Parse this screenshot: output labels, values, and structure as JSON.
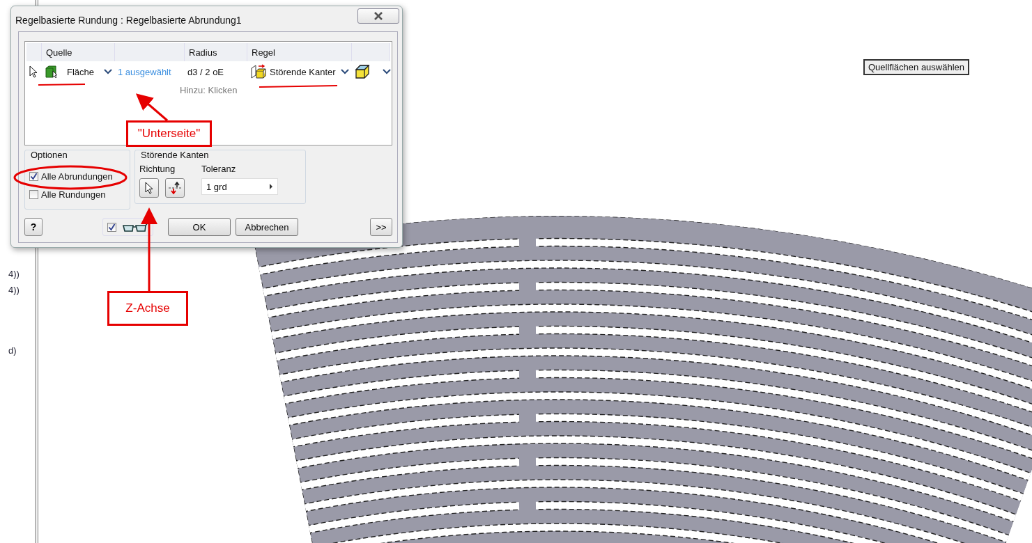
{
  "dialog": {
    "title": "Regelbasierte Rundung : Regelbasierte Abrundung1",
    "table": {
      "columns": [
        {
          "label": "Quelle"
        },
        {
          "label": "Radius"
        },
        {
          "label": "Regel"
        }
      ],
      "rows": [
        {
          "source": "Fläche",
          "selection": "1 ausgewählt",
          "radius": "d3 / 2 oE",
          "rule": "Störende Kanter"
        }
      ],
      "add_hint": "Hinzu: Klicken"
    },
    "options": {
      "title": "Optionen",
      "checkboxes": [
        {
          "label": "Alle Abrundungen",
          "checked": true
        },
        {
          "label": "Alle Rundungen",
          "checked": false
        }
      ]
    },
    "interfering_edges": {
      "title": "Störende Kanten",
      "direction_label": "Richtung",
      "tolerance_label": "Toleranz",
      "tolerance_value": "1 grd"
    },
    "help_button": "?",
    "preview": {
      "checked": true
    },
    "action_buttons": [
      "OK",
      "Abbrechen"
    ],
    "expand_button": ">>"
  },
  "tooltip": "Quellflächen auswählen",
  "side_texts": [
    "4))",
    "4))",
    "d)"
  ],
  "annotations": [
    {
      "text": "\"Unterseite\""
    },
    {
      "text": "Z-Achse"
    }
  ]
}
